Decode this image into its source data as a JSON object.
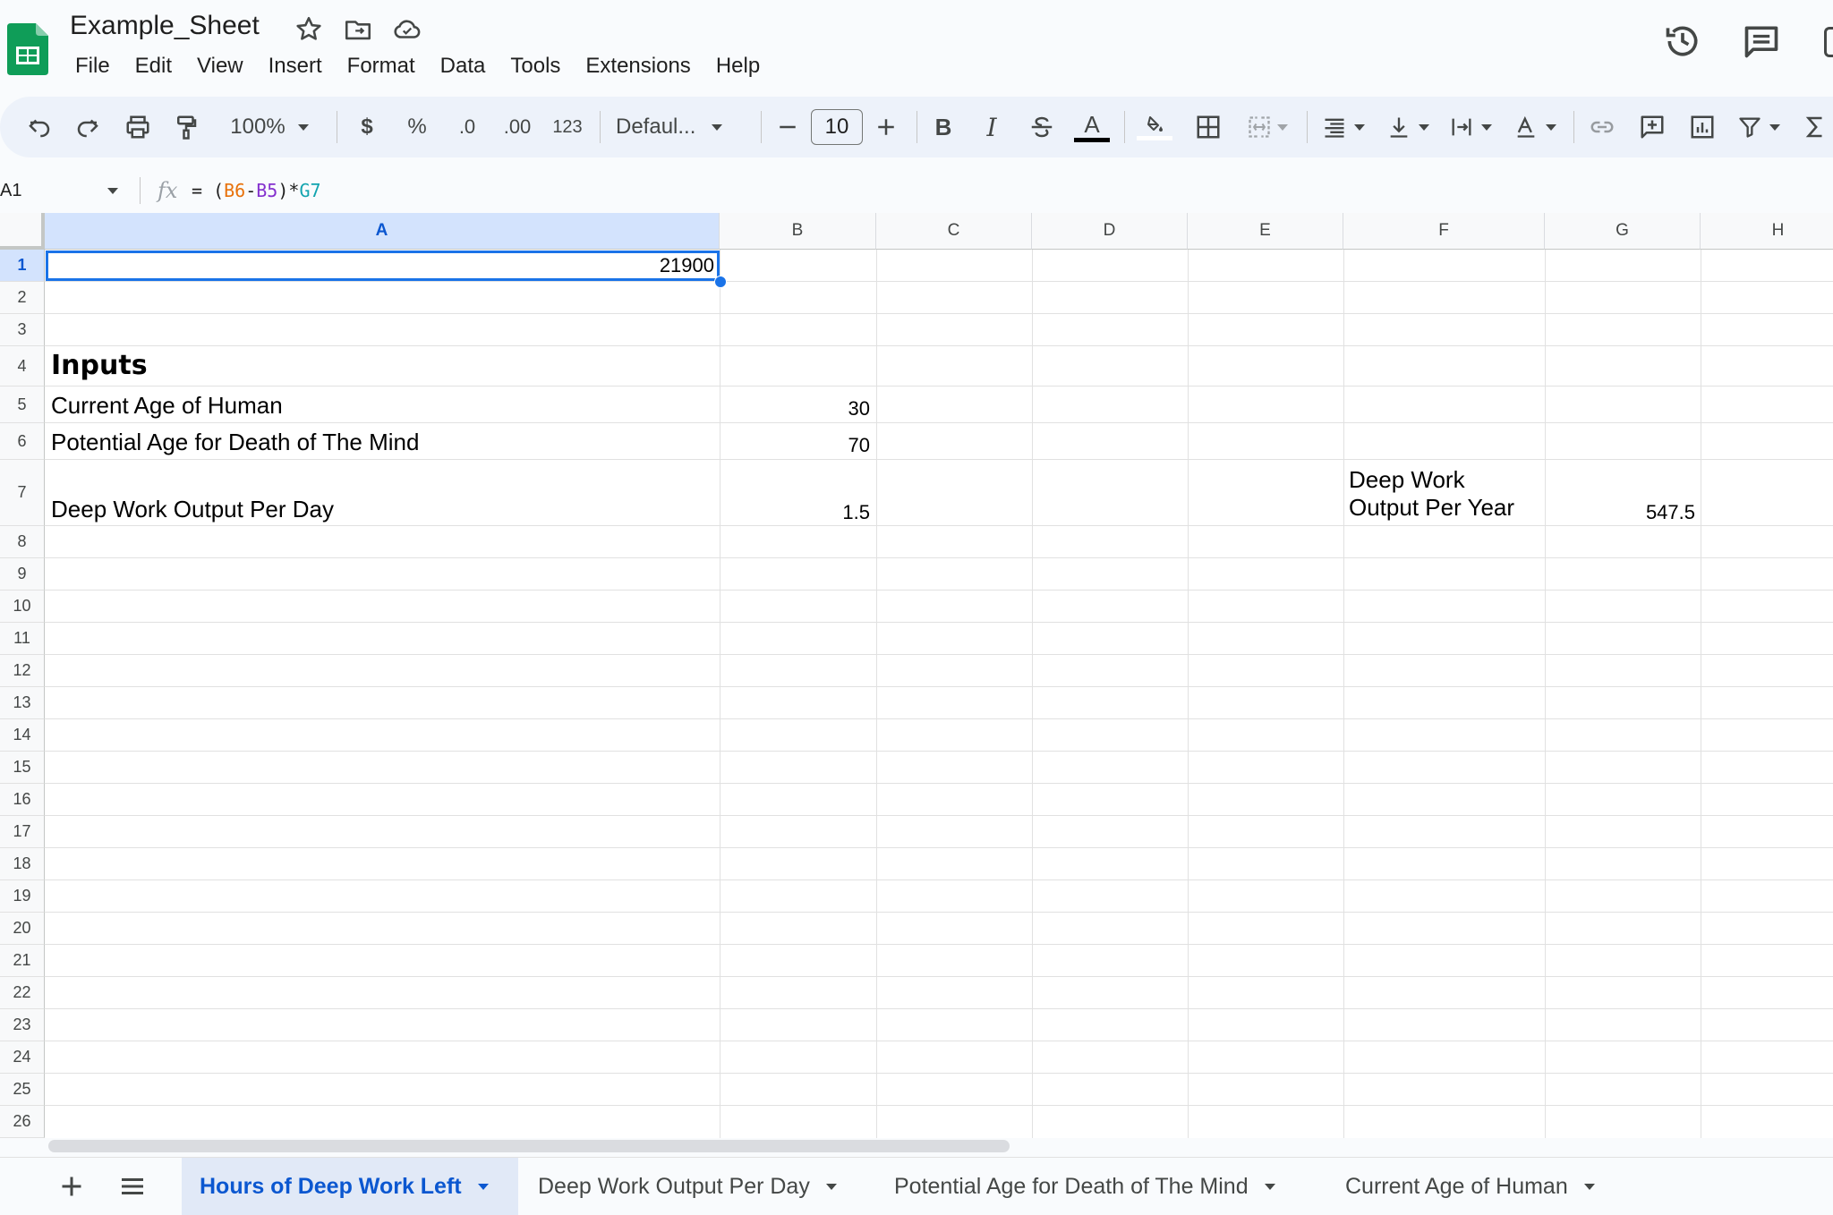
{
  "doc": {
    "title": "Example_Sheet"
  },
  "menu": [
    "File",
    "Edit",
    "View",
    "Insert",
    "Format",
    "Data",
    "Tools",
    "Extensions",
    "Help"
  ],
  "toolbar": {
    "zoom": "100%",
    "currency": "$",
    "percent": "%",
    "dec_decrease": ".0",
    "dec_increase": ".00",
    "more_formats": "123",
    "font": "Defaul...",
    "font_size": "10",
    "bold": "B",
    "italic": "I",
    "text_color_letter": "A",
    "text_color_swatch": "#000000"
  },
  "formula_bar": {
    "name_box": "A1",
    "fx": "fx",
    "formula": {
      "eq": "= (",
      "ref1": "B6",
      "minus": "-",
      "ref2": "B5",
      "mid": ")*",
      "ref3": "G7"
    },
    "ref_colors": {
      "B6": "#e8710a",
      "B5": "#8430ce",
      "G7": "#12a4af"
    }
  },
  "columns": [
    "A",
    "B",
    "C",
    "D",
    "E",
    "F",
    "G",
    "H"
  ],
  "rows": [
    "1",
    "2",
    "3",
    "4",
    "5",
    "6",
    "7",
    "8",
    "9",
    "10",
    "11",
    "12",
    "13",
    "14",
    "15",
    "16",
    "17",
    "18",
    "19",
    "20",
    "21",
    "22",
    "23",
    "24",
    "25",
    "26"
  ],
  "cells": {
    "A1": "21900",
    "A4": "Inputs",
    "A5": "Current Age of Human",
    "B5": "30",
    "A6": "Potential Age for Death of The Mind",
    "B6": "70",
    "A7": "Deep Work Output Per Day",
    "B7": "1.5",
    "F7_line1": "Deep Work",
    "F7_line2": "Output Per Year",
    "G7": "547.5"
  },
  "sheets": [
    {
      "label": "Hours of Deep Work Left",
      "active": true
    },
    {
      "label": "Deep Work Output Per Day",
      "active": false
    },
    {
      "label": "Potential Age for Death of The Mind",
      "active": false
    },
    {
      "label": "Current Age of Human",
      "active": false
    }
  ],
  "colors": {
    "accent": "#0b57d0",
    "selection": "#1a73e8",
    "sheets_green": "#0f9d58"
  }
}
